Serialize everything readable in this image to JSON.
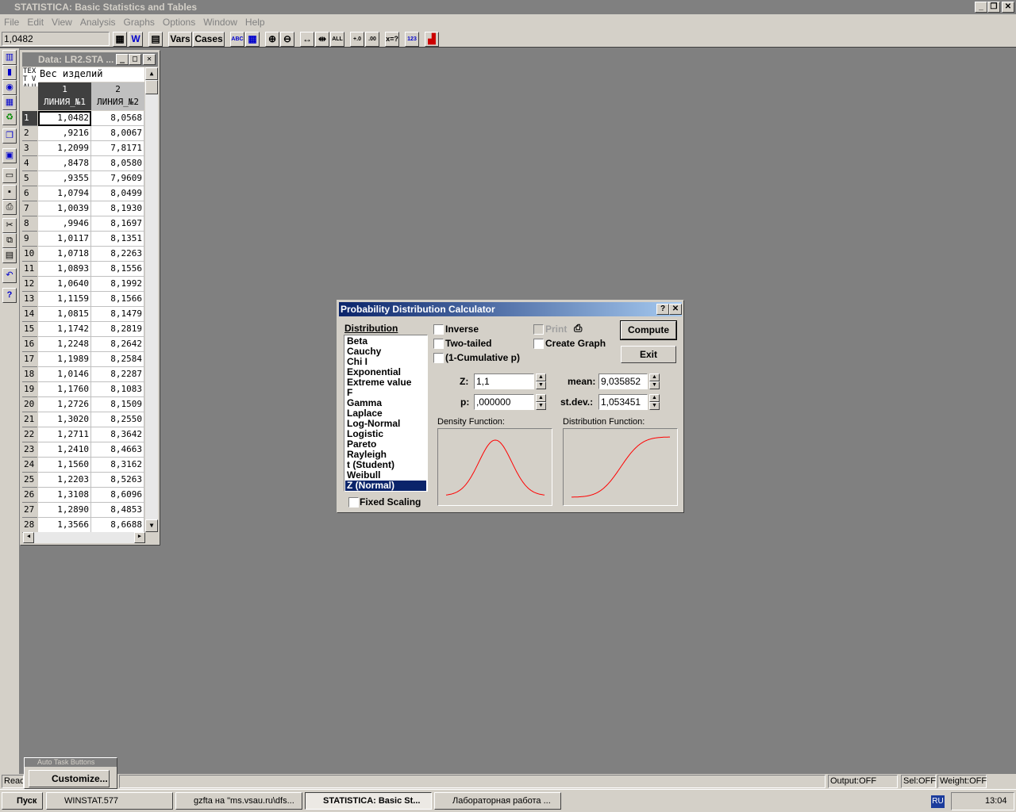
{
  "app": {
    "title": "STATISTICA: Basic Statistics and Tables"
  },
  "menu": [
    "File",
    "Edit",
    "View",
    "Analysis",
    "Graphs",
    "Options",
    "Window",
    "Help"
  ],
  "toolbar": {
    "cell_value": "1,0482",
    "vars": "Vars",
    "cases": "Cases"
  },
  "data_window": {
    "title": "Data: LR2.STA ...",
    "text_label": "TEXT VALUES",
    "subtitle": "Вес изделий",
    "columns": [
      {
        "num": "1",
        "name": "ЛИНИЯ_№1"
      },
      {
        "num": "2",
        "name": "ЛИНИЯ_№2"
      }
    ],
    "rows": [
      [
        "1",
        "1,0482",
        "8,0568"
      ],
      [
        "2",
        ",9216",
        "8,0067"
      ],
      [
        "3",
        "1,2099",
        "7,8171"
      ],
      [
        "4",
        ",8478",
        "8,0580"
      ],
      [
        "5",
        ",9355",
        "7,9609"
      ],
      [
        "6",
        "1,0794",
        "8,0499"
      ],
      [
        "7",
        "1,0039",
        "8,1930"
      ],
      [
        "8",
        ",9946",
        "8,1697"
      ],
      [
        "9",
        "1,0117",
        "8,1351"
      ],
      [
        "10",
        "1,0718",
        "8,2263"
      ],
      [
        "11",
        "1,0893",
        "8,1556"
      ],
      [
        "12",
        "1,0640",
        "8,1992"
      ],
      [
        "13",
        "1,1159",
        "8,1566"
      ],
      [
        "14",
        "1,0815",
        "8,1479"
      ],
      [
        "15",
        "1,1742",
        "8,2819"
      ],
      [
        "16",
        "1,2248",
        "8,2642"
      ],
      [
        "17",
        "1,1989",
        "8,2584"
      ],
      [
        "18",
        "1,0146",
        "8,2287"
      ],
      [
        "19",
        "1,1760",
        "8,1083"
      ],
      [
        "20",
        "1,2726",
        "8,1509"
      ],
      [
        "21",
        "1,3020",
        "8,2550"
      ],
      [
        "22",
        "1,2711",
        "8,3642"
      ],
      [
        "23",
        "1,2410",
        "8,4663"
      ],
      [
        "24",
        "1,1560",
        "8,3162"
      ],
      [
        "25",
        "1,2203",
        "8,5263"
      ],
      [
        "26",
        "1,3108",
        "8,6096"
      ],
      [
        "27",
        "1,2890",
        "8,4853"
      ],
      [
        "28",
        "1,3566",
        "8,6688"
      ]
    ]
  },
  "dialog": {
    "title": "Probability Distribution Calculator",
    "distribution_label": "Distribution",
    "distributions": [
      "Beta",
      "Cauchy",
      "Chi I",
      "Exponential",
      "Extreme value",
      "F",
      "Gamma",
      "Laplace",
      "Log-Normal",
      "Logistic",
      "Pareto",
      "Rayleigh",
      "t (Student)",
      "Weibull",
      "Z (Normal)"
    ],
    "selected": "Z (Normal)",
    "inverse": "Inverse",
    "two_tailed": "Two-tailed",
    "one_minus_cum": "(1-Cumulative p)",
    "print": "Print",
    "create_graph": "Create Graph",
    "compute": "Compute",
    "exit": "Exit",
    "z_label": "Z:",
    "z_value": "1,1",
    "p_label": "p:",
    "p_value": ",000000",
    "mean_label": "mean:",
    "mean_value": "9,035852",
    "sd_label": "st.dev.:",
    "sd_value": "1,053451",
    "density_label": "Density Function:",
    "distribution_fn_label": "Distribution Function:",
    "fixed_scaling": "Fixed Scaling",
    "curve_color": "#ff0000"
  },
  "auto_task": {
    "title": "Auto Task Buttons",
    "customize": "Customize..."
  },
  "status": {
    "ready": "Ready",
    "output": "Output:OFF",
    "sel": "Sel:OFF",
    "weight": "Weight:OFF"
  },
  "taskbar": {
    "start": "Пуск",
    "tasks": [
      "WINSTAT.577",
      "gzfta на \"ms.vsau.ru\\dfs...",
      "STATISTICA: Basic St...",
      "Лабораторная работа ..."
    ],
    "lang": "RU",
    "time": "13:04"
  }
}
